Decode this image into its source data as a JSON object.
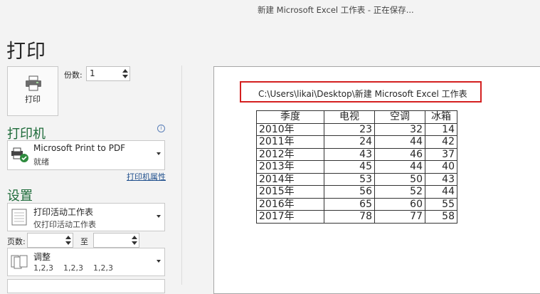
{
  "window": {
    "title": "新建 Microsoft Excel 工作表  -  正在保存..."
  },
  "page": {
    "heading": "打印"
  },
  "print": {
    "button_label": "打印",
    "copies_label": "份数:",
    "copies_value": "1"
  },
  "printer": {
    "section_title": "打印机",
    "info_icon": "i",
    "name": "Microsoft Print to PDF",
    "status": "就绪",
    "properties_link": "打印机属性"
  },
  "settings": {
    "section_title": "设置",
    "scope": {
      "title": "打印活动工作表",
      "subtitle": "仅打印活动工作表"
    },
    "pages_label": "页数:",
    "pages_to_label": "至",
    "pages_from": "",
    "pages_to": "",
    "collate": {
      "title": "调整",
      "subtitle": "1,2,3    1,2,3    1,2,3"
    }
  },
  "preview": {
    "path": "C:\\Users\\likai\\Desktop\\新建 Microsoft Excel 工作表",
    "table": {
      "headers": [
        "季度",
        "电视",
        "空调",
        "冰箱"
      ],
      "rows": [
        [
          "2010年",
          "23",
          "32",
          "14"
        ],
        [
          "2011年",
          "24",
          "44",
          "42"
        ],
        [
          "2012年",
          "43",
          "46",
          "37"
        ],
        [
          "2013年",
          "45",
          "44",
          "40"
        ],
        [
          "2014年",
          "53",
          "50",
          "43"
        ],
        [
          "2015年",
          "56",
          "52",
          "44"
        ],
        [
          "2016年",
          "65",
          "60",
          "55"
        ],
        [
          "2017年",
          "78",
          "77",
          "58"
        ]
      ]
    }
  },
  "colors": {
    "section": "#1e6b3a",
    "highlight_border": "#d42020",
    "link": "#1e4e8c"
  }
}
